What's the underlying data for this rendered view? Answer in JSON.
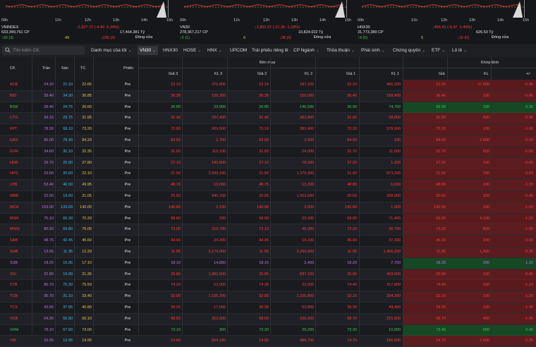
{
  "indices": [
    {
      "name": "VNINDEX",
      "times": [
        "09h",
        "11h",
        "12h",
        "13h",
        "14h",
        "15h"
      ],
      "change": "↓1,627.72 (-4.40 -0.24%)",
      "volume": "633,349,761 CP",
      "value": "17,464.381 Tỷ",
      "status": "Đóng cửa",
      "up": "↑93 (3)",
      "ref": "49",
      "down": "↓235 (2)"
    },
    {
      "name": "VN30",
      "times": [
        "09h",
        "11h",
        "12h",
        "13h",
        "14h",
        "15h"
      ],
      "change": "↓1,801.57 (-21.39 -1.18%)",
      "volume": "278,367,217 CP",
      "value": "10,824.022 Tỷ",
      "status": "Đóng cửa",
      "up": "↑2 (1)",
      "ref": "0",
      "down": "↓28 (0)"
    },
    {
      "name": "HNX30",
      "times": [
        "09h",
        "11h",
        "12h",
        "13h",
        "14h",
        "15h"
      ],
      "change": "↓455.41 (-6.47 -1.40%)",
      "volume": "31,773,380 CP",
      "value": "626.53 Tỷ",
      "status": "Đóng cửa",
      "up": "↑9 (0)",
      "ref": "5",
      "down": "↓16 (0)"
    }
  ],
  "search": {
    "placeholder": "Tìm kiếm CK"
  },
  "tabs": [
    {
      "label": "Danh mục của tôi",
      "chevron": "⌄",
      "active": false
    },
    {
      "label": "VN30",
      "chevron": "⌄",
      "active": true
    },
    {
      "label": "HNX30",
      "chevron": "",
      "active": false
    },
    {
      "label": "HOSE",
      "chevron": "⌄",
      "active": false
    },
    {
      "label": "HNX",
      "chevron": "⌄",
      "active": false
    },
    {
      "label": "UPCOM",
      "chevron": "",
      "active": false
    },
    {
      "label": "Trái phiếu riêng lẻ",
      "chevron": "",
      "active": false
    },
    {
      "label": "CP Ngành",
      "chevron": "⌄",
      "active": false
    },
    {
      "label": "Thỏa thuận",
      "chevron": "⌄",
      "active": false
    },
    {
      "label": "Phái sinh",
      "chevron": "⌄",
      "active": false
    },
    {
      "label": "Chứng quyền",
      "chevron": "⌄",
      "active": false
    },
    {
      "label": "ETF",
      "chevron": "⌄",
      "active": false
    },
    {
      "label": "Lô lẻ",
      "chevron": "⌄",
      "active": false
    }
  ],
  "headers": {
    "ck": "CK",
    "tran": "Trần",
    "san": "Sàn",
    "tc": "TC",
    "phien": "Phiên",
    "ben_mua": "Bên mua",
    "khop_lenh": "Khớp lệnh",
    "gia3": "Giá 3",
    "kl3": "KL 3",
    "gia2": "Giá 2",
    "kl2": "KL 2",
    "gia1": "Giá 1",
    "kl1": "KL 1",
    "gia": "Giá",
    "kl": "KL",
    "pm": "+/-"
  },
  "rows": [
    {
      "ck": "ACB",
      "tran": "24.20",
      "san": "21.10",
      "tc": "22.65",
      "phien": "Pre",
      "g3": "22.10",
      "kl3": "376,800",
      "g2": "22.15",
      "kl2": "187,100",
      "g1": "22.20",
      "kl1": "466,200",
      "gia": "22.20",
      "kl": "37,000",
      "pm": "-0.45",
      "c": "dn"
    },
    {
      "ck": "BID",
      "tran": "39.40",
      "san": "34.30",
      "tc": "36.85",
      "phien": "Pre",
      "g3": "36.30",
      "kl3": "109,300",
      "g2": "36.35",
      "kl2": "150,000",
      "g1": "36.40",
      "kl1": "169,400",
      "gia": "36.40",
      "kl": "100",
      "pm": "-0.45",
      "c": "dn"
    },
    {
      "ck": "BSR",
      "tran": "28.45",
      "san": "24.75",
      "tc": "26.60",
      "phien": "Pre",
      "g3": "26.80",
      "kl3": "23,900",
      "g2": "26.85",
      "kl2": "146,500",
      "g1": "26.90",
      "kl1": "74,700",
      "gia": "26.90",
      "kl": "100",
      "pm": "0.30",
      "c": "up"
    },
    {
      "ck": "CTG",
      "tran": "34.15",
      "san": "29.75",
      "tc": "31.95",
      "phien": "Pre",
      "g3": "31.40",
      "kl3": "297,400",
      "g2": "31.45",
      "kl2": "282,800",
      "g1": "31.50",
      "kl1": "28,800",
      "gia": "31.50",
      "kl": "600",
      "pm": "-0.45",
      "c": "dn"
    },
    {
      "ck": "FPT",
      "tran": "78.30",
      "san": "68.10",
      "tc": "73.20",
      "phien": "Pre",
      "g3": "72.00",
      "kl3": "909,500",
      "g2": "72.10",
      "kl2": "383,400",
      "g1": "72.20",
      "kl1": "579,900",
      "gia": "72.20",
      "kl": "100",
      "pm": "-1.00",
      "c": "dn"
    },
    {
      "ck": "GAS",
      "tran": "90.00",
      "san": "78.40",
      "tc": "84.20",
      "phien": "Pre",
      "g3": "83.60",
      "kl3": "1,700",
      "g2": "83.90",
      "kl2": "2,500",
      "g1": "84.00",
      "kl1": "100",
      "gia": "84.00",
      "kl": "2,000",
      "pm": "-0.20",
      "c": "dn"
    },
    {
      "ck": "GVR",
      "tran": "34.60",
      "san": "30.10",
      "tc": "32.35",
      "phien": "Pre",
      "g3": "31.60",
      "kl3": "110,100",
      "g2": "31.65",
      "kl2": "24,000",
      "g1": "31.70",
      "kl1": "11,000",
      "gia": "31.70",
      "kl": "600",
      "pm": "-0.65",
      "c": "dn"
    },
    {
      "ck": "HDB",
      "tran": "29.70",
      "san": "25.90",
      "tc": "27.80",
      "phien": "Pre",
      "g3": "27.10",
      "kl3": "180,800",
      "g2": "27.15",
      "kl2": "78,500",
      "g1": "27.20",
      "kl1": "1,200",
      "gia": "27.20",
      "kl": "100",
      "pm": "-0.60",
      "c": "dn"
    },
    {
      "ck": "HPG",
      "tran": "23.60",
      "san": "20.60",
      "tc": "22.10",
      "phien": "Pre",
      "g3": "21.50",
      "kl3": "2,099,100",
      "g2": "21.55",
      "kl2": "1,379,300",
      "g1": "21.60",
      "kl1": "873,100",
      "gia": "21.60",
      "kl": "200",
      "pm": "-0.50",
      "c": "dn"
    },
    {
      "ck": "LPB",
      "tran": "53.40",
      "san": "46.50",
      "tc": "49.95",
      "phien": "Pre",
      "g3": "48.70",
      "kl3": "19,000",
      "g2": "48.75",
      "kl2": "13,300",
      "g1": "48.80",
      "kl1": "6,600",
      "gia": "48.80",
      "kl": "100",
      "pm": "-1.15",
      "c": "dn"
    },
    {
      "ck": "MBB",
      "tran": "22.50",
      "san": "19.60",
      "tc": "21.05",
      "phien": "Pre",
      "g3": "20.50",
      "kl3": "940,100",
      "g2": "20.55",
      "kl2": "1,003,600",
      "g1": "20.60",
      "kl1": "208,900",
      "gia": "20.60",
      "kl": "300",
      "pm": "-0.45",
      "c": "dn"
    },
    {
      "ck": "MCH",
      "tran": "153.00",
      "san": "133.00",
      "tc": "143.00",
      "phien": "Pre",
      "g3": "140.80",
      "kl3": "2,100",
      "g2": "140.90",
      "kl2": "3,000",
      "g1": "141.00",
      "kl1": "1,000",
      "gia": "142.00",
      "kl": "200",
      "pm": "-1.00",
      "c": "dn"
    },
    {
      "ck": "MSN",
      "tran": "75.10",
      "san": "65.30",
      "tc": "70.20",
      "phien": "Pre",
      "g3": "68.80",
      "kl3": "200",
      "g2": "68.90",
      "kl2": "23,300",
      "g1": "69.00",
      "kl1": "71,400",
      "gia": "69.00",
      "kl": "4,100",
      "pm": "-1.20",
      "c": "dn"
    },
    {
      "ck": "MWG",
      "tran": "80.20",
      "san": "69.80",
      "tc": "75.00",
      "phien": "Pre",
      "g3": "73.00",
      "kl3": "216,700",
      "g2": "73.10",
      "kl2": "46,000",
      "g1": "73.20",
      "kl1": "36,700",
      "gia": "73.20",
      "kl": "800",
      "pm": "-1.80",
      "c": "dn"
    },
    {
      "ck": "SAB",
      "tran": "48.75",
      "san": "42.45",
      "tc": "45.60",
      "phien": "Pre",
      "g3": "44.90",
      "kl3": "24,300",
      "g2": "44.95",
      "kl2": "10,100",
      "g1": "45.00",
      "kl1": "37,300",
      "gia": "45.00",
      "kl": "200",
      "pm": "-0.60",
      "c": "dn"
    },
    {
      "ck": "SHB",
      "tran": "13.05",
      "san": "11.35",
      "tc": "12.20",
      "phien": "Pre",
      "g3": "11.85",
      "kl3": "3,174,000",
      "g2": "11.90",
      "kl2": "3,290,800",
      "g1": "11.95",
      "kl1": "1,456,200",
      "gia": "11.95",
      "kl": "1,000",
      "pm": "-0.25",
      "c": "dn"
    },
    {
      "ck": "SSB",
      "tran": "18.25",
      "san": "15.95",
      "tc": "17.10",
      "phien": "Pre",
      "g3": "18.10",
      "kl3": "14,800",
      "g2": "18.15",
      "kl2": "3,400",
      "g1": "18.20",
      "kl1": "7,700",
      "gia": "18.25",
      "kl": "200",
      "pm": "1.15",
      "c": "ceil"
    },
    {
      "ck": "SSI",
      "tran": "22.80",
      "san": "19.90",
      "tc": "21.35",
      "phien": "Pre",
      "g3": "20.80",
      "kl3": "1,882,500",
      "g2": "20.85",
      "kl2": "697,100",
      "g1": "20.90",
      "kl1": "403,600",
      "gia": "20.90",
      "kl": "100",
      "pm": "-0.45",
      "c": "dn"
    },
    {
      "ck": "STB",
      "tran": "80.70",
      "san": "70.30",
      "tc": "75.50",
      "phien": "Pre",
      "g3": "74.20",
      "kl3": "52,000",
      "g2": "74.30",
      "kl2": "32,600",
      "g1": "74.40",
      "kl1": "317,800",
      "gia": "74.40",
      "kl": "500",
      "pm": "-1.10",
      "c": "dn"
    },
    {
      "ck": "TCB",
      "tran": "35.70",
      "san": "31.10",
      "tc": "33.40",
      "phien": "Pre",
      "g3": "32.00",
      "kl3": "1,155,200",
      "g2": "32.05",
      "kl2": "1,155,800",
      "g1": "32.10",
      "kl1": "294,200",
      "gia": "32.10",
      "kl": "100",
      "pm": "-1.30",
      "c": "dn"
    },
    {
      "ck": "TCX",
      "tran": "43.65",
      "san": "37.95",
      "tc": "40.80",
      "phien": "Pre",
      "g3": "39.25",
      "kl3": "17,000",
      "g2": "39.30",
      "kl2": "52,800",
      "g1": "39.35",
      "kl1": "44,400",
      "gia": "39.35",
      "kl": "100",
      "pm": "-1.45",
      "c": "dn"
    },
    {
      "ck": "VCB",
      "tran": "64.30",
      "san": "55.90",
      "tc": "60.10",
      "phien": "Pre",
      "g3": "58.50",
      "kl3": "310,500",
      "g2": "58.60",
      "kl2": "166,600",
      "g1": "58.70",
      "kl1": "215,800",
      "gia": "58.70",
      "kl": "400",
      "pm": "-1.40",
      "c": "dn"
    },
    {
      "ck": "VHM",
      "tran": "78.10",
      "san": "67.90",
      "tc": "73.00",
      "phien": "Pre",
      "g3": "73.10",
      "kl3": "300",
      "g2": "73.20",
      "kl2": "29,200",
      "g1": "73.30",
      "kl1": "10,900",
      "gia": "73.40",
      "kl": "600",
      "pm": "0.40",
      "c": "up"
    },
    {
      "ck": "VIB",
      "tran": "15.95",
      "san": "13.95",
      "tc": "14.95",
      "phien": "Pre",
      "g3": "14.60",
      "kl3": "504,100",
      "g2": "14.65",
      "kl2": "489,700",
      "g1": "14.70",
      "kl1": "166,600",
      "gia": "14.70",
      "kl": "2,000",
      "pm": "-0.25",
      "c": "dn"
    }
  ],
  "colors": {
    "up": "#2fd14b",
    "down": "#ff3b3b",
    "ref": "#e8c54a",
    "ceil": "#c96cf2",
    "floor": "#43b7e8"
  }
}
